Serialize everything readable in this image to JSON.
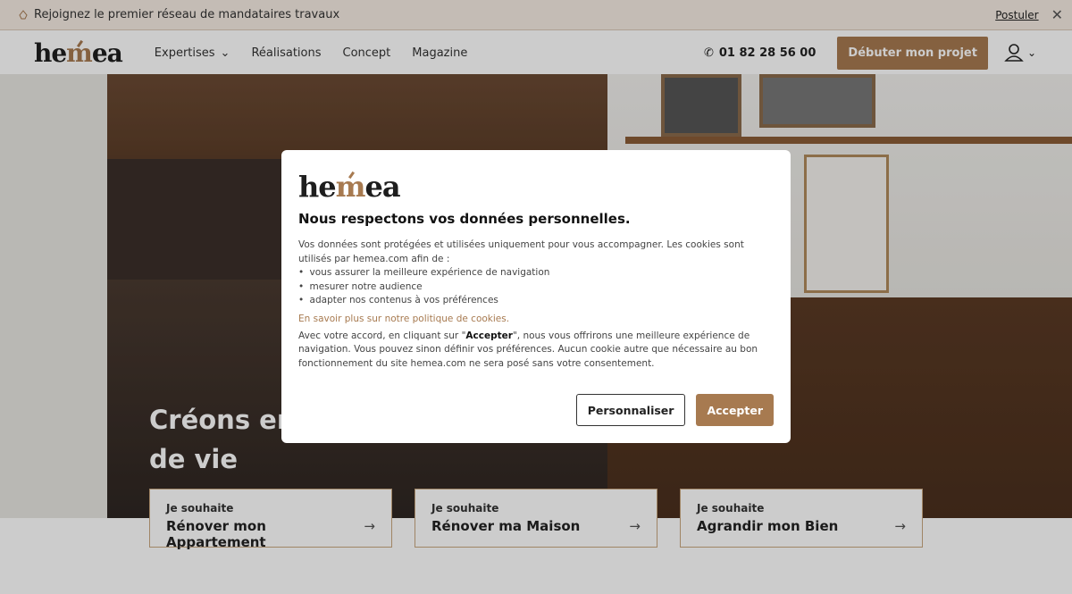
{
  "topbar": {
    "message": "Rejoignez le premier réseau de mandataires travaux",
    "link": "Postuler",
    "close": "✕"
  },
  "nav": {
    "logo_a": "he",
    "logo_m": "m",
    "logo_b": "ea",
    "items": [
      "Expertises",
      "Réalisations",
      "Concept",
      "Magazine"
    ],
    "phone": "01 82 28 56 00",
    "cta": "Débuter mon projet"
  },
  "hero": {
    "title_line1": "Créons ensemble votre lieu",
    "title_line2": "de vie"
  },
  "cards": [
    {
      "kicker": "Je souhaite",
      "label": "Rénover mon Appartement"
    },
    {
      "kicker": "Je souhaite",
      "label": "Rénover ma Maison"
    },
    {
      "kicker": "Je souhaite",
      "label": "Agrandir mon Bien"
    }
  ],
  "modal": {
    "title": "Nous respectons vos données personnelles.",
    "intro": "Vos données sont protégées et utilisées uniquement pour vous accompagner. Les cookies sont utilisés par hemea.com afin de :",
    "bullets": [
      "vous assurer la meilleure expérience de navigation",
      "mesurer notre audience",
      "adapter nos contenus à vos préférences"
    ],
    "more_link": "En savoir plus sur notre politique de cookies.",
    "para_pre": "Avec votre accord, en cliquant sur \"",
    "para_bold": "Accepter",
    "para_post": "\", nous vous offrirons une meilleure expérience de navigation. Vous pouvez sinon définir vos préférences. Aucun cookie autre que nécessaire au bon fonctionnement du site hemea.com ne sera posé sans votre consentement.",
    "customize": "Personnaliser",
    "accept": "Accepter"
  },
  "colors": {
    "accent": "#a77a50"
  }
}
